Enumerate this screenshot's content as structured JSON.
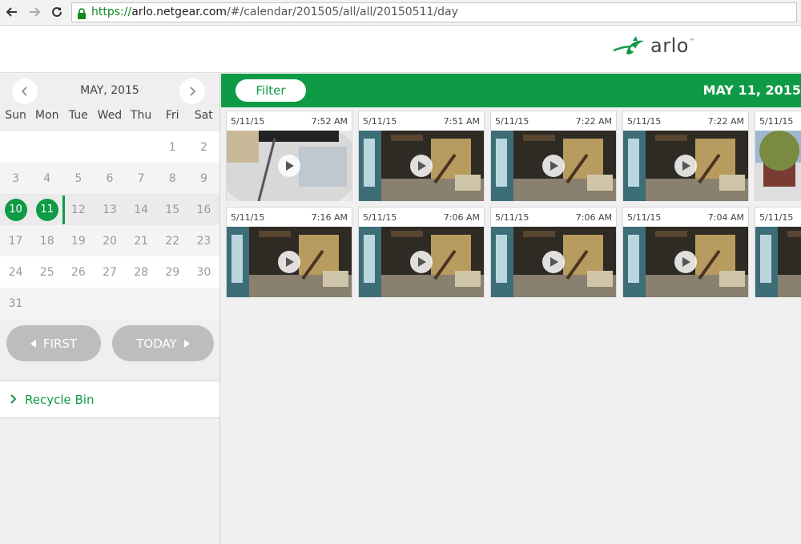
{
  "browser": {
    "url_scheme": "https://",
    "url_host": "arlo.netgear.com",
    "url_path": "/#/calendar/201505/all/all/20150511/day"
  },
  "header": {
    "logo_text": "arlo",
    "logo_tm": "™"
  },
  "calendar": {
    "title": "MAY, 2015",
    "days_of_week": [
      "Sun",
      "Mon",
      "Tue",
      "Wed",
      "Thu",
      "Fri",
      "Sat"
    ],
    "weeks": [
      [
        "",
        "",
        "",
        "",
        "",
        "1",
        "2"
      ],
      [
        "3",
        "4",
        "5",
        "6",
        "7",
        "8",
        "9"
      ],
      [
        "10",
        "11",
        "12",
        "13",
        "14",
        "15",
        "16"
      ],
      [
        "17",
        "18",
        "19",
        "20",
        "21",
        "22",
        "23"
      ],
      [
        "24",
        "25",
        "26",
        "27",
        "28",
        "29",
        "30"
      ],
      [
        "31",
        "",
        "",
        "",
        "",
        "",
        ""
      ]
    ],
    "highlighted_days": [
      "10",
      "11"
    ],
    "first_label": "FIRST",
    "today_label": "TODAY"
  },
  "sidebar": {
    "recycle_label": "Recycle Bin"
  },
  "main": {
    "filter_label": "Filter",
    "date_title": "MAY 11, 2015",
    "clips": [
      {
        "date": "5/11/15",
        "time": "7:52 AM"
      },
      {
        "date": "5/11/15",
        "time": "7:51 AM"
      },
      {
        "date": "5/11/15",
        "time": "7:22 AM"
      },
      {
        "date": "5/11/15",
        "time": "7:22 AM"
      },
      {
        "date": "5/11/15",
        "time": ""
      },
      {
        "date": "5/11/15",
        "time": "7:16 AM"
      },
      {
        "date": "5/11/15",
        "time": "7:06 AM"
      },
      {
        "date": "5/11/15",
        "time": "7:06 AM"
      },
      {
        "date": "5/11/15",
        "time": "7:04 AM"
      },
      {
        "date": "5/11/15",
        "time": ""
      }
    ]
  },
  "colors": {
    "accent": "#0f9b45",
    "pill": "#bdbdbd"
  }
}
